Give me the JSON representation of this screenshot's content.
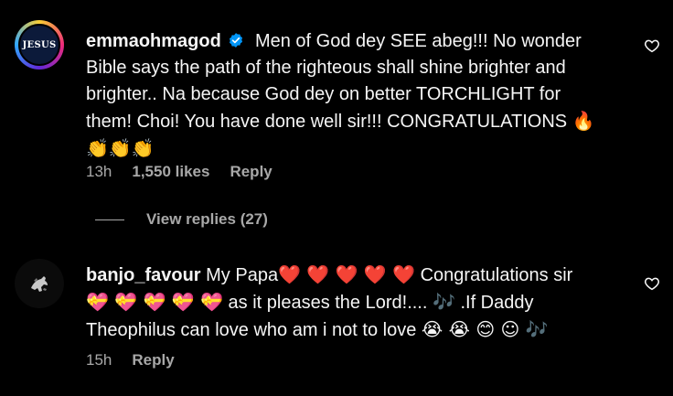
{
  "comments": [
    {
      "avatar_text": "JESUS",
      "username": "emmaohmagod",
      "verified": true,
      "text_1": "Men of God dey SEE abeg!!! No wonder Bible says the path of the righteous shall shine brighter and brighter.. Na because God dey on better TORCHLIGHT for them! Choi! You have done well sir!!! CONGRATULATIONS",
      "emoji_1": "🔥",
      "emoji_2": "👏👏👏",
      "time": "13h",
      "likes": "1,550 likes",
      "reply": "Reply",
      "view_replies": "View replies (27)"
    },
    {
      "username": "banjo_favour",
      "text_1": "My Papa",
      "hearts_1": "❤️ ❤️ ❤️ ❤️ ❤️",
      "text_2": "Congratulations sir",
      "hearts_2": "💝 💝 💝 💝 💝",
      "text_3": "as it pleases the Lord!....",
      "emoji_music_1": "🎶",
      "text_4": ".If Daddy Theophilus can love who am i not to love",
      "emoji_end": "😭 😭 😊 ☺ 🎶",
      "time": "15h",
      "reply": "Reply"
    }
  ],
  "icons": [
    "verified-badge-icon",
    "heart-outline-icon"
  ],
  "colors": {
    "background": "#000000",
    "text": "#f5f5f5",
    "muted": "#a8a8a8",
    "verified": "#0095f6"
  }
}
